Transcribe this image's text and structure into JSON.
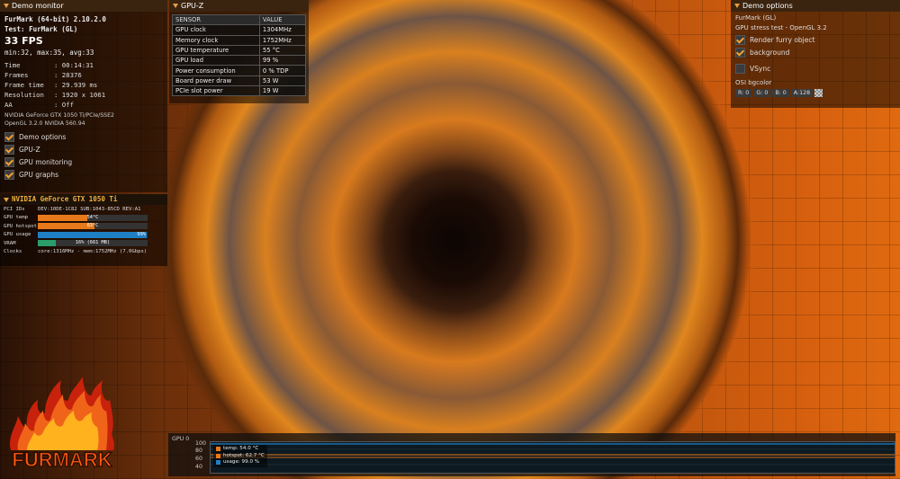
{
  "monitor": {
    "title": "Demo monitor",
    "app": "FurMark (64-bit) 2.10.2.0",
    "test": "Test: FurMark (GL)",
    "fps": "33 FPS",
    "minmax": "min:32, max:35, avg:33",
    "stats": [
      {
        "k": "Time",
        "v": ": 00:14:31"
      },
      {
        "k": "Frames",
        "v": ": 28376"
      },
      {
        "k": "Frame time",
        "v": ": 29.939 ms"
      },
      {
        "k": "Resolution",
        "v": ": 1920 x 1061"
      },
      {
        "k": "AA",
        "v": ": Off"
      }
    ],
    "gpu_name": "NVIDIA GeForce GTX 1050 Ti/PCIe/SSE2",
    "gl_version": "OpenGL 3.2.0 NVIDIA 560.94",
    "checks": [
      {
        "label": "Demo options",
        "checked": true
      },
      {
        "label": "GPU-Z",
        "checked": true
      },
      {
        "label": "GPU monitoring",
        "checked": true
      },
      {
        "label": "GPU graphs",
        "checked": true
      }
    ]
  },
  "gpu": {
    "title": "NVIDIA GeForce GTX 1050 Ti",
    "pci_label": "PCI IDs",
    "pci_value": "DEV:10DE-1C82 SUB:1043-85CD REV:A1",
    "rows": [
      {
        "label": "GPU temp",
        "text": "54°C",
        "level": 0.45,
        "color": "#e8791a"
      },
      {
        "label": "GPU hotspot",
        "text": "63°C",
        "level": 0.52,
        "color": "#e8791a"
      },
      {
        "label": "GPU usage",
        "text": "99%",
        "level": 0.99,
        "color": "#1f7fc4"
      },
      {
        "label": "VRAM",
        "text": "16% (661 MB)",
        "level": 0.16,
        "color": "#2a9d6a"
      }
    ],
    "clocks_label": "Clocks",
    "clocks_value": "core:1316MHz - mem:1752MHz (7.0Gbps)"
  },
  "gpuz": {
    "title": "GPU-Z",
    "header": {
      "sensor": "SENSOR",
      "value": "VALUE"
    },
    "rows": [
      {
        "sensor": "GPU clock",
        "value": "1304MHz"
      },
      {
        "sensor": "Memory clock",
        "value": "1752MHz"
      },
      {
        "sensor": "GPU temperature",
        "value": "55 °C"
      },
      {
        "sensor": "GPU load",
        "value": "99 %"
      },
      {
        "sensor": "Power consumption",
        "value": "0 % TDP"
      },
      {
        "sensor": "Board power draw",
        "value": "53 W"
      },
      {
        "sensor": "PCIe slot power",
        "value": "19 W"
      }
    ]
  },
  "options": {
    "title": "Demo options",
    "line1": "FurMark (GL)",
    "line2": "GPU stress test - OpenGL 3.2",
    "checks": [
      {
        "label": "Render furry object",
        "checked": true
      },
      {
        "label": "background",
        "checked": true
      },
      {
        "label": "VSync",
        "checked": false
      }
    ],
    "bgcolor_label": "OSI bgcolor",
    "bgcolor": {
      "r": "R: 0",
      "g": "G: 0",
      "b": "B: 0",
      "a": "A:128"
    }
  },
  "logo": {
    "text": "FURMARK"
  },
  "graph": {
    "label": "GPU 0",
    "yticks": [
      "100",
      "80",
      "60",
      "40"
    ],
    "legend": [
      {
        "text": "temp: 54.0 °C",
        "color": "#e8791a"
      },
      {
        "text": "hotspot: 62.7 °C",
        "color": "#e8791a"
      },
      {
        "text": "usage: 99.0 %",
        "color": "#1f7fc4"
      }
    ]
  },
  "colors": {
    "accent": "#f0a030",
    "temp": "#e8791a",
    "usage": "#1f7fc4",
    "vram": "#2a9d6a"
  }
}
